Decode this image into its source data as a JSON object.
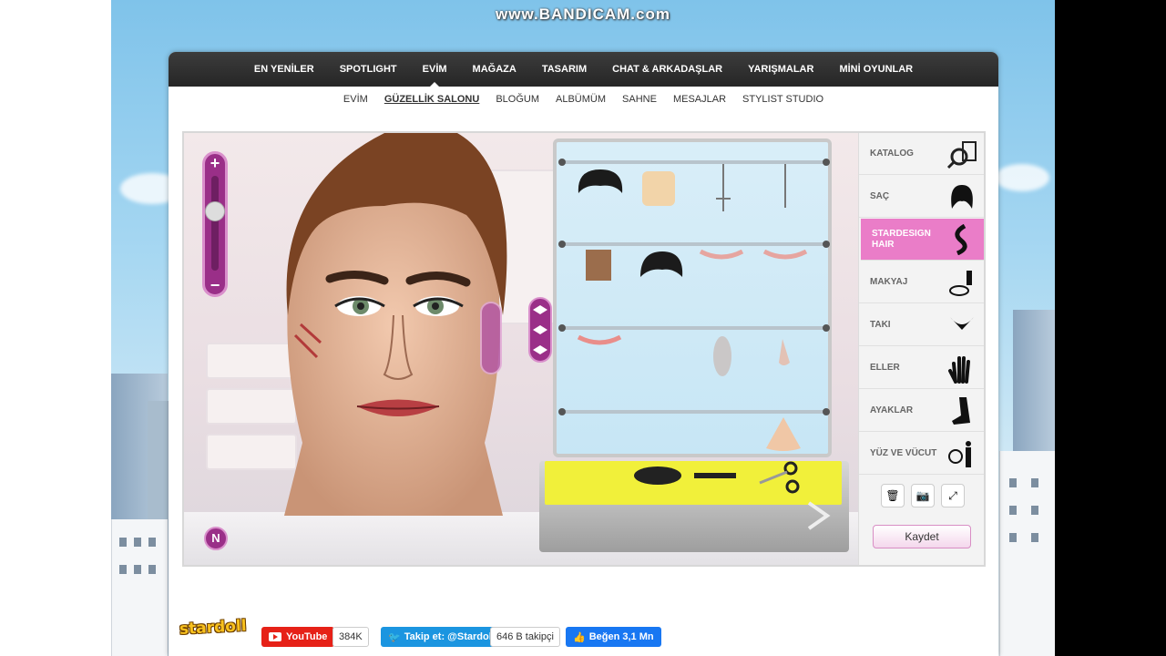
{
  "watermark": "www.BANDICAM.com",
  "top_nav": [
    "EN YENİLER",
    "SPOTLIGHT",
    "EVİM",
    "MAĞAZA",
    "TASARIM",
    "CHAT & ARKADAŞLAR",
    "YARIŞMALAR",
    "MİNİ OYUNLAR"
  ],
  "top_nav_active": "EVİM",
  "sub_nav": [
    "EVİM",
    "GÜZELLİK SALONU",
    "BLOĞUM",
    "ALBÜMÜM",
    "SAHNE",
    "MESAJLAR",
    "STYLIST STUDIO"
  ],
  "sub_nav_active": "GÜZELLİK SALONU",
  "categories": [
    {
      "label": "KATALOG",
      "icon": "magnifier-icon"
    },
    {
      "label": "SAÇ",
      "icon": "hair-icon"
    },
    {
      "label": "STARDESIGN HAIR",
      "icon": "stardesign-hair-icon"
    },
    {
      "label": "MAKYAJ",
      "icon": "makeup-icon"
    },
    {
      "label": "TAKI",
      "icon": "jewelry-icon"
    },
    {
      "label": "ELLER",
      "icon": "hand-icon"
    },
    {
      "label": "AYAKLAR",
      "icon": "foot-icon"
    },
    {
      "label": "YÜZ VE VÜCUT",
      "icon": "body-icon"
    }
  ],
  "categories_active": "STARDESIGN HAIR",
  "tools": [
    {
      "icon": "trash-icon"
    },
    {
      "icon": "camera-icon"
    },
    {
      "icon": "fullscreen-icon"
    }
  ],
  "save_label": "Kaydet",
  "zoom": {
    "plus": "+",
    "minus": "−"
  },
  "footer": {
    "logo": "stardoll",
    "youtube_label": "YouTube",
    "youtube_count": "384K",
    "twitter_label": "Takip et: @Stardoll",
    "twitter_count": "646 B takipçi",
    "facebook_label": "Beğen 3,1 Mn"
  },
  "colors": {
    "accent": "#9a2f88",
    "active_category": "#ea7dc8",
    "youtube": "#e62117",
    "twitter": "#1b95e0",
    "facebook": "#1877f2"
  }
}
